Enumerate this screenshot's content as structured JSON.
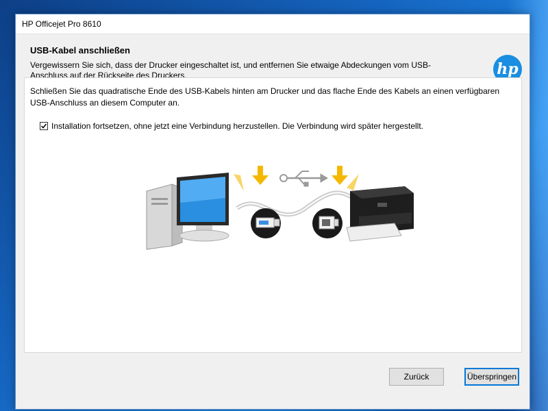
{
  "window": {
    "title": "HP Officejet Pro 8610"
  },
  "header": {
    "title": "USB-Kabel anschließen",
    "description": "Vergewissern Sie sich, dass der Drucker eingeschaltet ist, und entfernen Sie etwaige Abdeckungen vom USB-Anschluss auf der Rückseite des Druckers.",
    "logo_text": "hp"
  },
  "content": {
    "instruction": "Schließen Sie das quadratische Ende des USB-Kabels hinten am Drucker und das flache Ende des Kabels an einen verfügbaren USB-Anschluss an diesem Computer an.",
    "checkbox_label": "Installation fortsetzen, ohne jetzt eine Verbindung herzustellen. Die Verbindung wird später hergestellt.",
    "checkbox_checked": true
  },
  "buttons": {
    "back_label": "Zurück",
    "skip_label": "Überspringen"
  },
  "colors": {
    "hp_blue": "#1a8ee0",
    "arrow_yellow": "#f5b800",
    "focus_blue": "#0078d7"
  },
  "icons": [
    "hp-logo",
    "computer-icon",
    "printer-icon",
    "usb-symbol-icon",
    "usb-flat-connector-icon",
    "usb-square-connector-icon",
    "down-arrow-icon",
    "checkmark-icon"
  ]
}
